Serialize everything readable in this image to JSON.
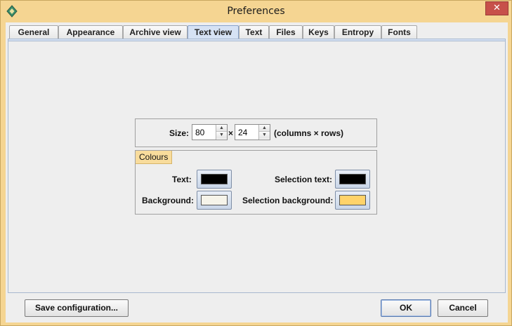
{
  "window": {
    "title": "Preferences",
    "close_glyph": "✕",
    "app_icon": "app-logo-icon"
  },
  "tabs": [
    {
      "label": "General"
    },
    {
      "label": "Appearance"
    },
    {
      "label": "Archive view"
    },
    {
      "label": "Text view",
      "active": true
    },
    {
      "label": "Text"
    },
    {
      "label": "Files"
    },
    {
      "label": "Keys"
    },
    {
      "label": "Entropy"
    },
    {
      "label": "Fonts"
    }
  ],
  "size": {
    "label": "Size:",
    "columns": "80",
    "times": "×",
    "rows": "24",
    "suffix": "(columns × rows)",
    "spin_up_icon": "▲",
    "spin_down_icon": "▼"
  },
  "colours": {
    "legend": "Colours",
    "text_label": "Text:",
    "text_color": "#000000",
    "background_label": "Background:",
    "background_color": "#f6f4ea",
    "selection_text_label": "Selection text:",
    "selection_text_color": "#000000",
    "selection_background_label": "Selection background:",
    "selection_background_color": "#ffd36a"
  },
  "buttons": {
    "save": "Save configuration...",
    "ok": "OK",
    "cancel": "Cancel"
  }
}
